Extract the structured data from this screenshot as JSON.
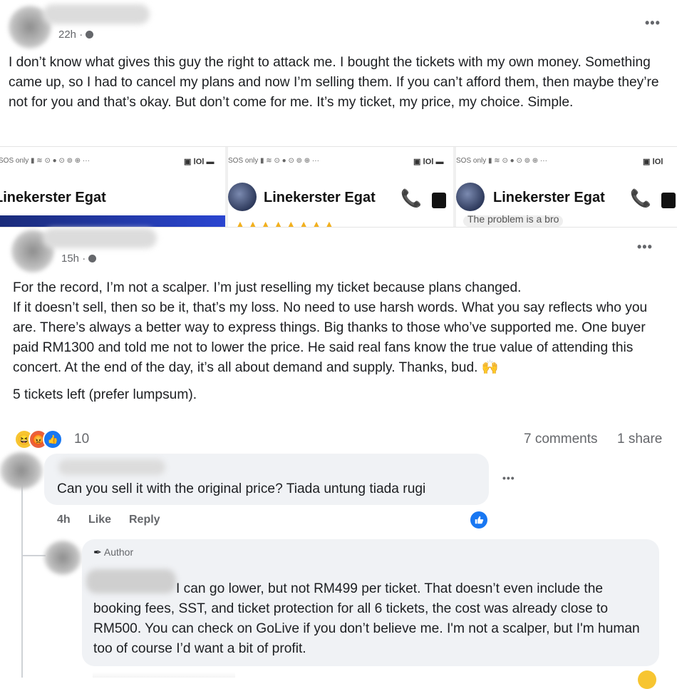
{
  "post1": {
    "time": "22h ·",
    "text": "I don’t know what gives this guy the right to attack me. I bought the tickets with my own money. Something came up, so I had to cancel my plans and now I’m selling them. If you can’t afford them, then maybe they’re not for you and that’s okay. But don’t come for me. It’s my ticket, my price, my choice. Simple."
  },
  "screenshots": {
    "status_left": "SOS only",
    "contact_name": "Linekerster Egat",
    "partial_text": "The problem is a bro"
  },
  "post2": {
    "time": "15h ·",
    "text_lines": [
      "For the record, I’m not a scalper. I’m just reselling my ticket because plans changed.",
      "If it doesn’t sell, then so be it, that’s my loss. No need to use harsh words. What you say reflects who you are. There’s always a better way to express things. Big thanks to those who’ve supported me. One buyer paid RM1300 and told me not to lower the price. He said real fans know the true value of attending this concert. At the end of the day, it’s all about demand and supply. Thanks, bud. 🙌",
      "5 tickets left (prefer lumpsum)."
    ],
    "reaction_count": "10",
    "comments_count": "7 comments",
    "shares_count": "1 share"
  },
  "comment1": {
    "text": "Can you sell it with the original price? Tiada untung tiada rugi",
    "time": "4h",
    "like_label": "Like",
    "reply_label": "Reply"
  },
  "reply1": {
    "badge": "Author",
    "text": "I can go lower, but not RM499 per ticket. That doesn’t even include the booking fees, SST, and ticket protection for all 6 tickets, the cost was already close to RM500. You can check on GoLive if you don’t believe me. I'm not a scalper, but I'm human too of course I’d want a bit of profit."
  },
  "colors": {
    "facebook_blue": "#1877f2",
    "bubble_bg": "#f0f2f5",
    "meta_gray": "#65676b"
  }
}
